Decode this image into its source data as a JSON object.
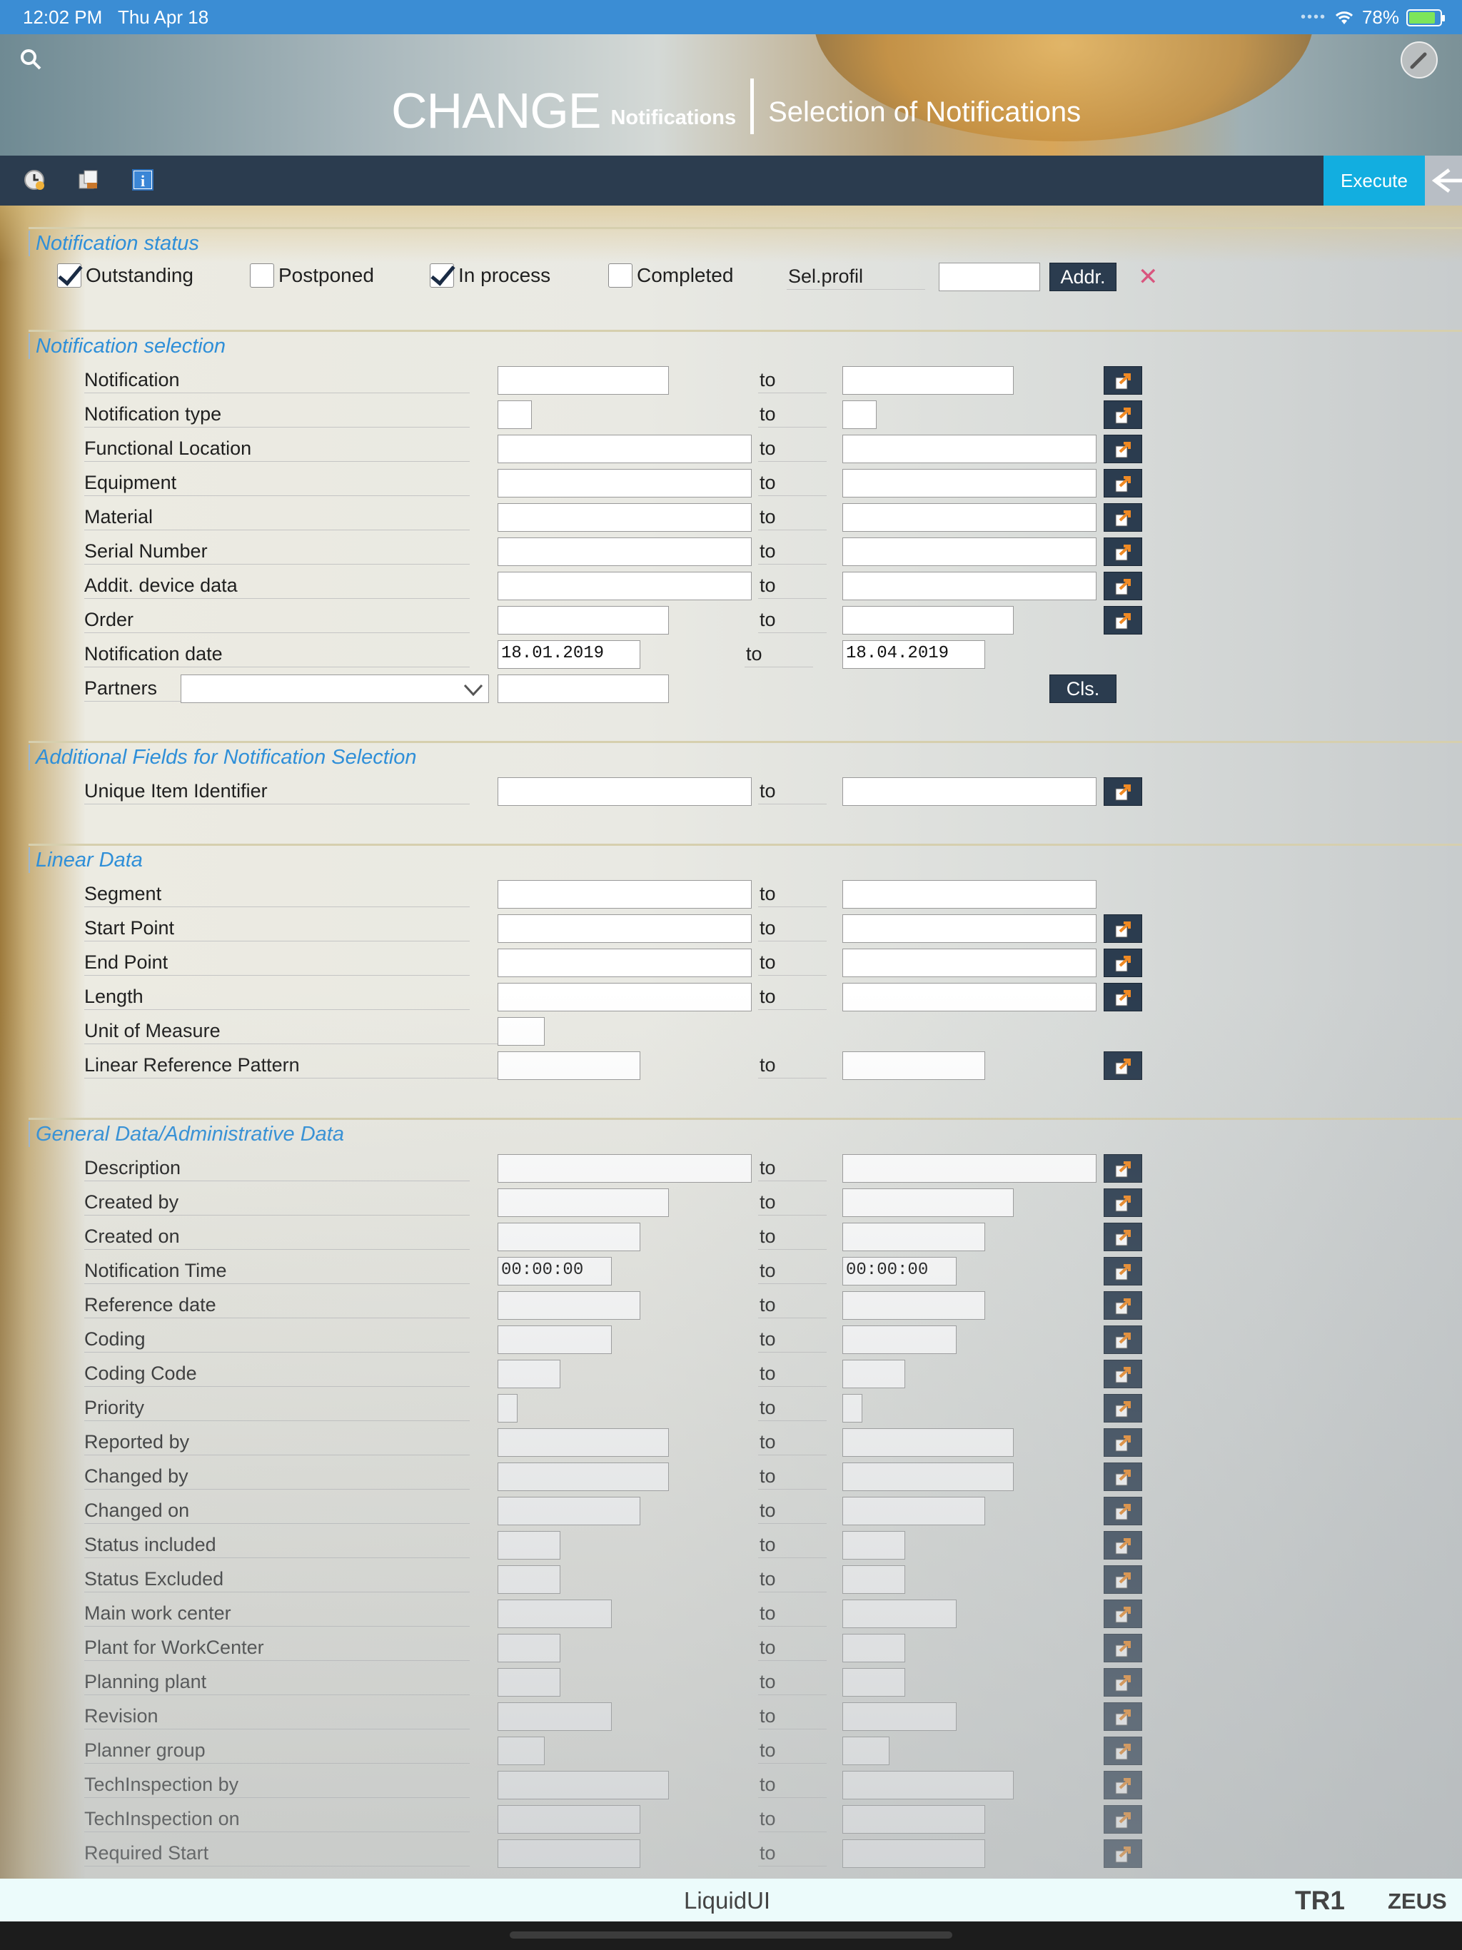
{
  "status_bar": {
    "time": "12:02 PM",
    "date": "Thu Apr 18",
    "battery": "78%"
  },
  "header": {
    "title_big": "CHANGE",
    "title_small": "Notifications",
    "subtitle": "Selection of Notifications",
    "icons": [
      "search-icon",
      "wrench-icon"
    ]
  },
  "toolbar": {
    "icons": [
      "clock-icon",
      "copy-icon",
      "info-icon"
    ],
    "execute_label": "Execute",
    "back_icon": "back-arrow-icon"
  },
  "colors": {
    "accent": "#12aee0",
    "section_title": "#2f8fd8",
    "dark_button": "#2b3c4f",
    "arrow": "#f08a24"
  },
  "sections": {
    "status": {
      "title": "Notification status",
      "checks": [
        {
          "label": "Outstanding",
          "checked": true
        },
        {
          "label": "Postponed",
          "checked": false
        },
        {
          "label": "In process",
          "checked": true
        },
        {
          "label": "Completed",
          "checked": false
        }
      ],
      "selprofil_label": "Sel.profil",
      "selprofil_value": "",
      "addr_label": "Addr.",
      "clear_icon": "close-icon"
    },
    "selection": {
      "title": "Notification selection",
      "rows": [
        {
          "label": "Notification",
          "from": "",
          "to": ""
        },
        {
          "label": "Notification type",
          "from": "",
          "to": ""
        },
        {
          "label": "Functional Location",
          "from": "",
          "to": ""
        },
        {
          "label": "Equipment",
          "from": "",
          "to": ""
        },
        {
          "label": "Material",
          "from": "",
          "to": ""
        },
        {
          "label": "Serial Number",
          "from": "",
          "to": ""
        },
        {
          "label": "Addit. device data",
          "from": "",
          "to": ""
        },
        {
          "label": "Order",
          "from": "",
          "to": ""
        },
        {
          "label": "Notification date",
          "from": "18.01.2019",
          "to": "18.04.2019"
        },
        {
          "label": "Partners",
          "from": "",
          "to": ""
        }
      ],
      "to_label": "to",
      "cls_label": "Cls."
    },
    "additional": {
      "title": "Additional Fields for Notification Selection",
      "rows": [
        {
          "label": "Unique Item Identifier",
          "from": "",
          "to": ""
        }
      ]
    },
    "linear": {
      "title": "Linear Data",
      "rows": [
        {
          "label": "Segment",
          "from": "",
          "to": ""
        },
        {
          "label": "Start Point",
          "from": "",
          "to": ""
        },
        {
          "label": "End Point",
          "from": "",
          "to": ""
        },
        {
          "label": "Length",
          "from": "",
          "to": ""
        },
        {
          "label": "Unit of Measure",
          "from": "",
          "to": ""
        },
        {
          "label": "Linear Reference Pattern",
          "from": "",
          "to": ""
        }
      ]
    },
    "general": {
      "title": "General Data/Administrative Data",
      "rows": [
        {
          "label": "Description",
          "from": "",
          "to": ""
        },
        {
          "label": "Created by",
          "from": "",
          "to": ""
        },
        {
          "label": "Created on",
          "from": "",
          "to": ""
        },
        {
          "label": "Notification Time",
          "from": "00:00:00",
          "to": "00:00:00"
        },
        {
          "label": "Reference date",
          "from": "",
          "to": ""
        },
        {
          "label": "Coding",
          "from": "",
          "to": ""
        },
        {
          "label": "Coding Code",
          "from": "",
          "to": ""
        },
        {
          "label": "Priority",
          "from": "",
          "to": ""
        },
        {
          "label": "Reported by",
          "from": "",
          "to": ""
        },
        {
          "label": "Changed by",
          "from": "",
          "to": ""
        },
        {
          "label": "Changed on",
          "from": "",
          "to": ""
        },
        {
          "label": "Status included",
          "from": "",
          "to": ""
        },
        {
          "label": "Status Excluded",
          "from": "",
          "to": ""
        },
        {
          "label": "Main work center",
          "from": "",
          "to": ""
        },
        {
          "label": "Plant for WorkCenter",
          "from": "",
          "to": ""
        },
        {
          "label": "Planning plant",
          "from": "",
          "to": ""
        },
        {
          "label": "Revision",
          "from": "",
          "to": ""
        },
        {
          "label": "Planner group",
          "from": "",
          "to": ""
        },
        {
          "label": "TechInspection by",
          "from": "",
          "to": ""
        },
        {
          "label": "TechInspection on",
          "from": "",
          "to": ""
        },
        {
          "label": "Required Start",
          "from": "",
          "to": ""
        }
      ]
    }
  },
  "footer": {
    "brand": "LiquidUI",
    "system": "TR1",
    "server": "ZEUS"
  }
}
